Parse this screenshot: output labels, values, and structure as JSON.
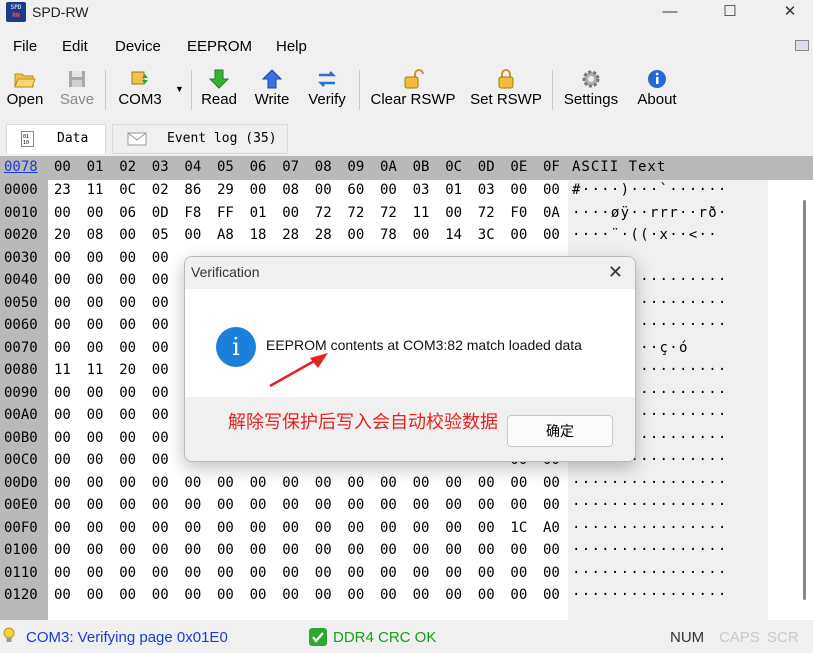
{
  "window": {
    "title": "SPD-RW",
    "icon_text_top": "SPD",
    "icon_text_bottom": "RW"
  },
  "menu": [
    "File",
    "Edit",
    "Device",
    "EEPROM",
    "Help"
  ],
  "toolbar": {
    "open": "Open",
    "save": "Save",
    "port": "COM3",
    "read": "Read",
    "write": "Write",
    "verify": "Verify",
    "clear_rswp": "Clear RSWP",
    "set_rswp": "Set RSWP",
    "settings": "Settings",
    "about": "About"
  },
  "tabs": {
    "data": "Data",
    "log": "Event log (35)"
  },
  "hex": {
    "corner": "0078",
    "columns": [
      "00",
      "01",
      "02",
      "03",
      "04",
      "05",
      "06",
      "07",
      "08",
      "09",
      "0A",
      "0B",
      "0C",
      "0D",
      "0E",
      "0F"
    ],
    "ascii_header": "ASCII Text",
    "rows": [
      {
        "addr": "0000",
        "bytes": [
          "23",
          "11",
          "0C",
          "02",
          "86",
          "29",
          "00",
          "08",
          "00",
          "60",
          "00",
          "03",
          "01",
          "03",
          "00",
          "00"
        ],
        "ascii": "#····)···`······"
      },
      {
        "addr": "0010",
        "bytes": [
          "00",
          "00",
          "06",
          "0D",
          "F8",
          "FF",
          "01",
          "00",
          "72",
          "72",
          "72",
          "11",
          "00",
          "72",
          "F0",
          "0A"
        ],
        "ascii": "····øÿ··rrr··rð·"
      },
      {
        "addr": "0020",
        "bytes": [
          "20",
          "08",
          "00",
          "05",
          "00",
          "A8",
          "18",
          "28",
          "28",
          "00",
          "78",
          "00",
          "14",
          "3C",
          "00",
          "00"
        ],
        "ascii": " ····¨·((·x··<··"
      },
      {
        "addr": "0030",
        "bytes": [
          "00",
          "00",
          "00",
          "00",
          "",
          "",
          "",
          "",
          "",
          "",
          "",
          "",
          "",
          "",
          "",
          ""
        ],
        "ascii": ""
      },
      {
        "addr": "0040",
        "bytes": [
          "00",
          "00",
          "00",
          "00",
          "",
          "",
          "",
          "",
          "",
          "",
          "",
          "",
          "",
          "",
          "",
          ""
        ],
        "ascii": "················"
      },
      {
        "addr": "0050",
        "bytes": [
          "00",
          "00",
          "00",
          "00",
          "",
          "",
          "",
          "",
          "",
          "",
          "",
          "",
          "",
          "",
          "",
          ""
        ],
        "ascii": "················"
      },
      {
        "addr": "0060",
        "bytes": [
          "00",
          "00",
          "00",
          "00",
          "",
          "",
          "",
          "",
          "",
          "",
          "",
          "",
          "",
          "",
          "",
          ""
        ],
        "ascii": "················"
      },
      {
        "addr": "0070",
        "bytes": [
          "00",
          "00",
          "00",
          "00",
          "",
          "",
          "",
          "",
          "",
          "",
          "",
          "",
          "",
          "",
          "",
          ""
        ],
        "ascii": "·····▯···ç·ó"
      },
      {
        "addr": "0080",
        "bytes": [
          "11",
          "11",
          "20",
          "00",
          "",
          "",
          "",
          "",
          "",
          "",
          "",
          "",
          "",
          "",
          "",
          ""
        ],
        "ascii": "················"
      },
      {
        "addr": "0090",
        "bytes": [
          "00",
          "00",
          "00",
          "00",
          "",
          "",
          "",
          "",
          "",
          "",
          "",
          "",
          "",
          "",
          "",
          ""
        ],
        "ascii": "················"
      },
      {
        "addr": "00A0",
        "bytes": [
          "00",
          "00",
          "00",
          "00",
          "",
          "",
          "",
          "",
          "",
          "",
          "",
          "",
          "",
          "",
          "",
          ""
        ],
        "ascii": "················"
      },
      {
        "addr": "00B0",
        "bytes": [
          "00",
          "00",
          "00",
          "00",
          "",
          "",
          "",
          "",
          "",
          "",
          "",
          "",
          "",
          "",
          "",
          ""
        ],
        "ascii": "················"
      },
      {
        "addr": "00C0",
        "bytes": [
          "00",
          "00",
          "00",
          "00",
          "",
          "",
          "",
          "",
          "",
          "",
          "",
          "",
          "",
          "",
          "00",
          "00"
        ],
        "ascii": "················"
      },
      {
        "addr": "00D0",
        "bytes": [
          "00",
          "00",
          "00",
          "00",
          "00",
          "00",
          "00",
          "00",
          "00",
          "00",
          "00",
          "00",
          "00",
          "00",
          "00",
          "00"
        ],
        "ascii": "················"
      },
      {
        "addr": "00E0",
        "bytes": [
          "00",
          "00",
          "00",
          "00",
          "00",
          "00",
          "00",
          "00",
          "00",
          "00",
          "00",
          "00",
          "00",
          "00",
          "00",
          "00"
        ],
        "ascii": "················"
      },
      {
        "addr": "00F0",
        "bytes": [
          "00",
          "00",
          "00",
          "00",
          "00",
          "00",
          "00",
          "00",
          "00",
          "00",
          "00",
          "00",
          "00",
          "00",
          "1C",
          "A0"
        ],
        "ascii": "················"
      },
      {
        "addr": "0100",
        "bytes": [
          "00",
          "00",
          "00",
          "00",
          "00",
          "00",
          "00",
          "00",
          "00",
          "00",
          "00",
          "00",
          "00",
          "00",
          "00",
          "00"
        ],
        "ascii": "················"
      },
      {
        "addr": "0110",
        "bytes": [
          "00",
          "00",
          "00",
          "00",
          "00",
          "00",
          "00",
          "00",
          "00",
          "00",
          "00",
          "00",
          "00",
          "00",
          "00",
          "00"
        ],
        "ascii": "················"
      },
      {
        "addr": "0120",
        "bytes": [
          "00",
          "00",
          "00",
          "00",
          "00",
          "00",
          "00",
          "00",
          "00",
          "00",
          "00",
          "00",
          "00",
          "00",
          "00",
          "00"
        ],
        "ascii": "················"
      }
    ]
  },
  "dialog": {
    "title": "Verification",
    "message": "EEPROM contents at COM3:82 match loaded data",
    "ok_label": "确定"
  },
  "annotation": {
    "text": "解除写保护后写入会自动校验数据",
    "color": "#e52121"
  },
  "status": {
    "left": "COM3: Verifying page 0x01E0",
    "crc": "DDR4 CRC OK",
    "num": "NUM",
    "caps": "CAPS",
    "scr": "SCR"
  }
}
